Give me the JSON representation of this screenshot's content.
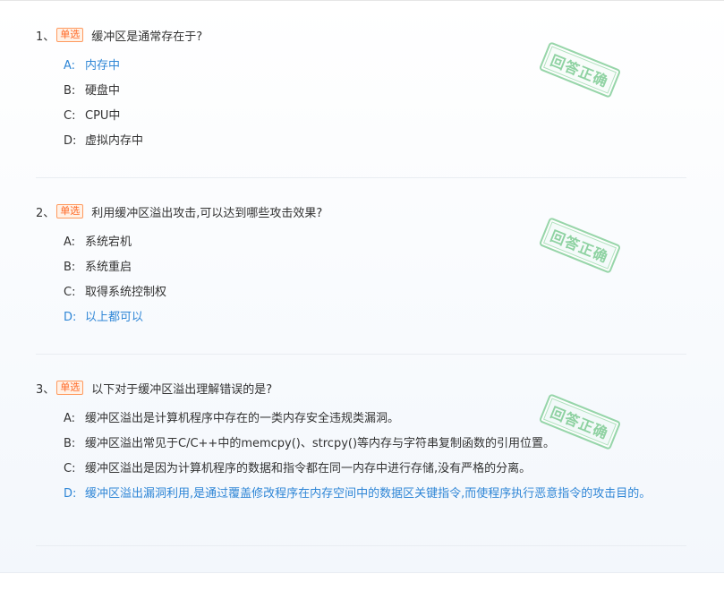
{
  "questions": [
    {
      "number": "1、",
      "type_label": "单选",
      "text": "缓冲区是通常存在于?",
      "stamp": "回答正确",
      "options": [
        {
          "letter": "A:",
          "text": "内存中",
          "correct": true
        },
        {
          "letter": "B:",
          "text": "硬盘中",
          "correct": false
        },
        {
          "letter": "C:",
          "text": "CPU中",
          "correct": false
        },
        {
          "letter": "D:",
          "text": "虚拟内存中",
          "correct": false
        }
      ]
    },
    {
      "number": "2、",
      "type_label": "单选",
      "text": "利用缓冲区溢出攻击,可以达到哪些攻击效果?",
      "stamp": "回答正确",
      "options": [
        {
          "letter": "A:",
          "text": "系统宕机",
          "correct": false
        },
        {
          "letter": "B:",
          "text": "系统重启",
          "correct": false
        },
        {
          "letter": "C:",
          "text": "取得系统控制权",
          "correct": false
        },
        {
          "letter": "D:",
          "text": "以上都可以",
          "correct": true
        }
      ]
    },
    {
      "number": "3、",
      "type_label": "单选",
      "text": "以下对于缓冲区溢出理解错误的是?",
      "stamp": "回答正确",
      "options": [
        {
          "letter": "A:",
          "text": "缓冲区溢出是计算机程序中存在的一类内存安全违规类漏洞。",
          "correct": false
        },
        {
          "letter": "B:",
          "text": "缓冲区溢出常见于C/C++中的memcpy()、strcpy()等内存与字符串复制函数的引用位置。",
          "correct": false
        },
        {
          "letter": "C:",
          "text": "缓冲区溢出是因为计算机程序的数据和指令都在同一内存中进行存储,没有严格的分离。",
          "correct": false
        },
        {
          "letter": "D:",
          "text": "缓冲区溢出漏洞利用,是通过覆盖修改程序在内存空间中的数据区关键指令,而使程序执行恶意指令的攻击目的。",
          "correct": true
        }
      ]
    }
  ],
  "colors": {
    "correct_option": "#2f86d6",
    "type_badge": "#ff6a28",
    "stamp": "#7ccb92"
  }
}
